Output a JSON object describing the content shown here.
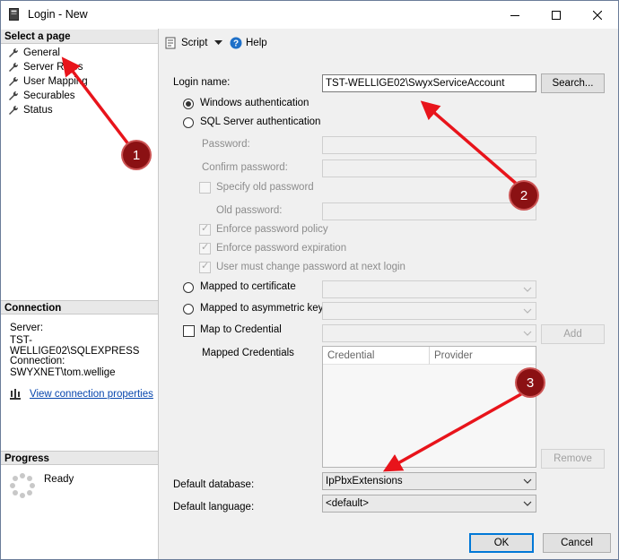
{
  "window": {
    "title": "Login - New"
  },
  "left": {
    "select_page_header": "Select a page",
    "pages": [
      {
        "label": "General"
      },
      {
        "label": "Server Roles"
      },
      {
        "label": "User Mapping"
      },
      {
        "label": "Securables"
      },
      {
        "label": "Status"
      }
    ],
    "connection_header": "Connection",
    "server_label": "Server:",
    "server_value": "TST-WELLIGE02\\SQLEXPRESS",
    "connection_label": "Connection:",
    "connection_value": "SWYXNET\\tom.wellige",
    "view_props_link": "View connection properties",
    "progress_header": "Progress",
    "progress_status": "Ready"
  },
  "toolbar": {
    "script_label": "Script",
    "help_label": "Help"
  },
  "form": {
    "login_name_label": "Login name:",
    "login_name_value": "TST-WELLIGE02\\SwyxServiceAccount",
    "search_button": "Search...",
    "windows_auth": "Windows authentication",
    "sql_auth": "SQL Server authentication",
    "password_label": "Password:",
    "confirm_password_label": "Confirm password:",
    "specify_old_password": "Specify old password",
    "old_password_label": "Old password:",
    "enforce_policy": "Enforce password policy",
    "enforce_expiration": "Enforce password expiration",
    "must_change": "User must change password at next login",
    "mapped_cert": "Mapped to certificate",
    "mapped_asym_key": "Mapped to asymmetric key",
    "map_credential": "Map to Credential",
    "add_button": "Add",
    "mapped_credentials_label": "Mapped Credentials",
    "cred_columns": [
      "Credential",
      "Provider"
    ],
    "remove_button": "Remove",
    "default_db_label": "Default database:",
    "default_db_value": "IpPbxExtensions",
    "default_lang_label": "Default language:",
    "default_lang_value": "<default>"
  },
  "buttons": {
    "ok": "OK",
    "cancel": "Cancel"
  },
  "annotations": {
    "badges": [
      "1",
      "2",
      "3"
    ],
    "arrow_color": "#e8141b",
    "badge_color": "#8b1113"
  }
}
